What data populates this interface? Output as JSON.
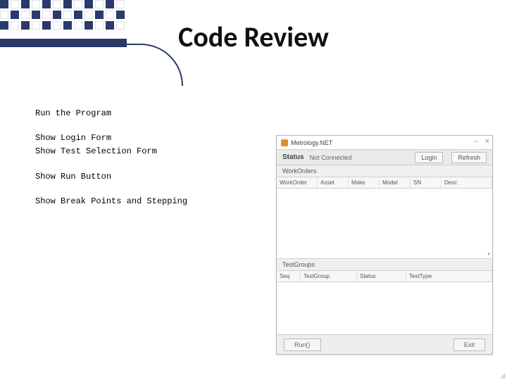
{
  "slide": {
    "title": "Code Review",
    "lines": {
      "l1": "Run the Program",
      "l2": "Show Login Form",
      "l3": "Show Test Selection Form",
      "l4": "Show Run Button",
      "l5": "Show Break Points and Stepping"
    }
  },
  "app": {
    "window_title": "Metrology.NET",
    "min": "–",
    "close": "×",
    "status_label": "Status",
    "status_value": "Not Connected",
    "login_btn": "Login",
    "refresh_btn": "Refresh",
    "workorders_label": "WorkOrders",
    "wo_cols": {
      "c1": "WorkOrder",
      "c2": "Asset",
      "c3": "Make",
      "c4": "Model",
      "c5": "SN",
      "c6": "Desc"
    },
    "testgroups_label": "TestGroups",
    "tg_cols": {
      "c1": "Seq",
      "c2": "TestGroup",
      "c3": "Status",
      "c4": "TestType"
    },
    "run_btn": "Run()",
    "exit_btn": "Exit"
  }
}
